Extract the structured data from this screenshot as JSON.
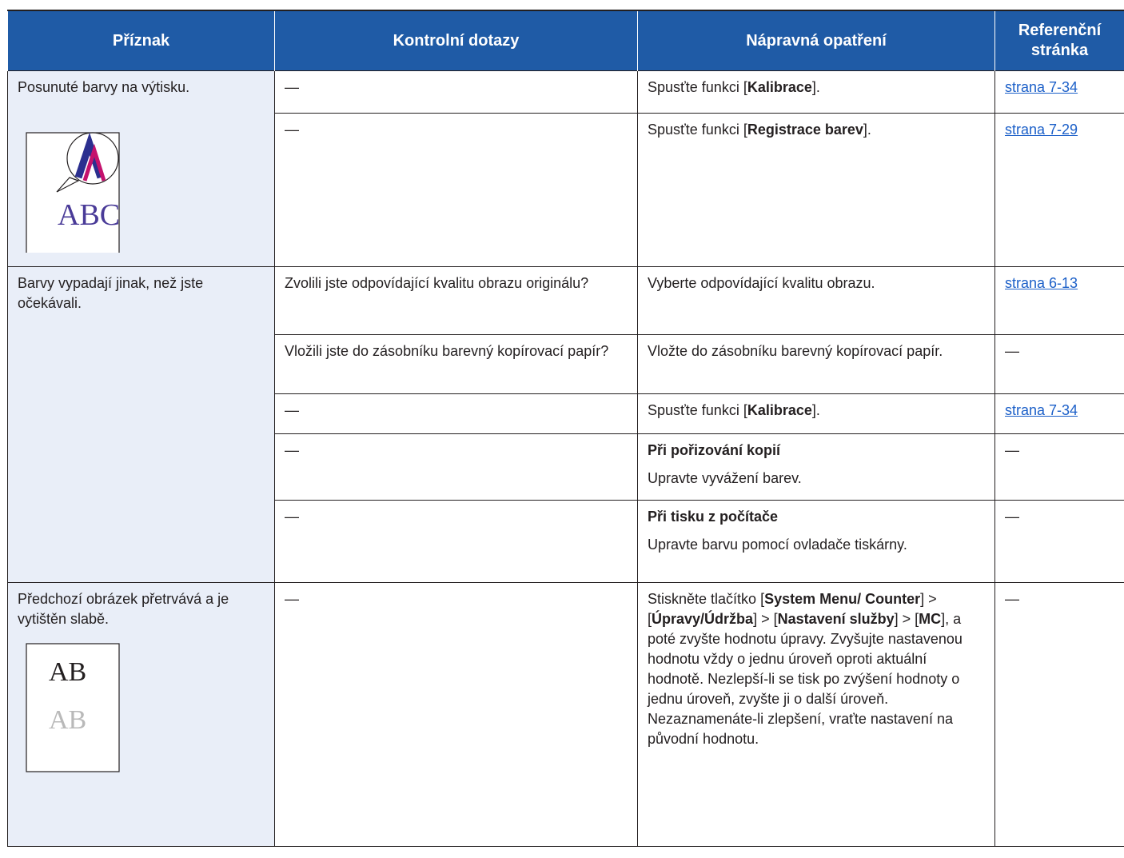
{
  "headers": [
    "Příznak",
    "Kontrolní dotazy",
    "Nápravná opatření",
    "Referenční stránka"
  ],
  "dash": "—",
  "rows": {
    "s1": {
      "symptom": "Posunuté barvy na výtisku.",
      "illustration_text": "ABC",
      "r1": {
        "remedy_pre": "Spusťte funkci [",
        "remedy_bold": "Kalibrace",
        "remedy_post": "].",
        "ref": "strana 7-34"
      },
      "r2": {
        "remedy_pre": "Spusťte funkci [",
        "remedy_bold": "Registrace barev",
        "remedy_post": "].",
        "ref": "strana 7-29"
      }
    },
    "s2": {
      "symptom": "Barvy vypadají jinak, než jste očekávali.",
      "r1": {
        "check": "Zvolili jste odpovídající kvalitu obrazu originálu?",
        "remedy": "Vyberte odpovídající kvalitu obrazu.",
        "ref": "strana 6-13"
      },
      "r2": {
        "check": "Vložili jste do zásobníku barevný kopírovací papír?",
        "remedy": "Vložte do zásobníku barevný kopírovací papír."
      },
      "r3": {
        "remedy_pre": "Spusťte funkci [",
        "remedy_bold": "Kalibrace",
        "remedy_post": "].",
        "ref": "strana 7-34"
      },
      "r4": {
        "remedy_heading": "Při pořizování kopií",
        "remedy": "Upravte vyvážení barev."
      },
      "r5": {
        "remedy_heading": "Při tisku z počítače",
        "remedy": "Upravte barvu pomocí ovladače tiskárny."
      }
    },
    "s3": {
      "symptom": "Předchozí obrázek přetrvává a je vytištěn slabě.",
      "illustration_text_1": "AB",
      "illustration_text_2": "AB",
      "r1": {
        "t1": "Stiskněte tlačítko [",
        "b1": "System Menu/ Counter",
        "t2": "] > [",
        "b2": "Úpravy/Údržba",
        "t3": "] > [",
        "b3": "Nastavení služby",
        "t4": "] > [",
        "b4": "MC",
        "t5": "], a poté zvyšte hodnotu úpravy. Zvyšujte nastavenou hodnotu vždy o jednu úroveň oproti aktuální hodnotě. Nezlepší-li se tisk po zvýšení hodnoty o jednu úroveň, zvyšte ji o další úroveň. Nezaznamenáte-li zlepšení, vraťte nastavení na původní hodnotu."
      }
    }
  },
  "colors": {
    "header_bg": "#1f5ba6",
    "symptom_bg": "#e9eef8",
    "link": "#1b5fc8",
    "illustration_navy": "#2b2f8f",
    "illustration_magenta": "#c4126d"
  }
}
